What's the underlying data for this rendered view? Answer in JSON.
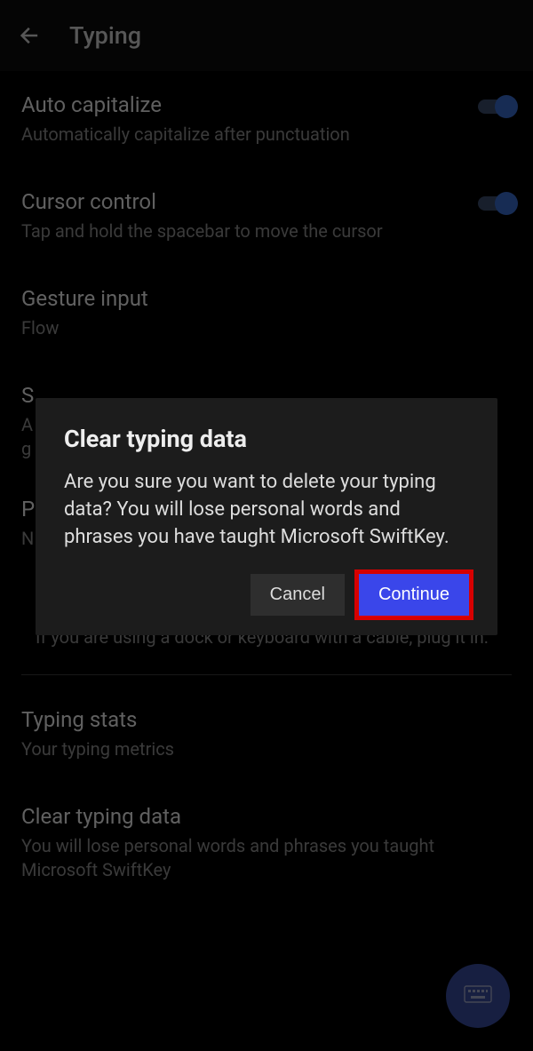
{
  "header": {
    "title": "Typing"
  },
  "settings": {
    "auto_capitalize": {
      "title": "Auto capitalize",
      "subtitle": "Automatically capitalize after punctuation"
    },
    "cursor_control": {
      "title": "Cursor control",
      "subtitle": "Tap and hold the spacebar to move the cursor"
    },
    "gesture_input": {
      "title": "Gesture input",
      "subtitle": "Flow"
    },
    "partial_top": {
      "title": "S",
      "subtitle_a": "A",
      "subtitle_b": "g"
    },
    "partial_mid": {
      "line1": "P",
      "line2": "N"
    },
    "dock_hint": "If you are using a dock or keyboard with a cable, plug it in.",
    "typing_stats": {
      "title": "Typing stats",
      "subtitle": "Your typing metrics"
    },
    "clear_typing_data": {
      "title": "Clear typing data",
      "subtitle": "You will lose personal words and phrases you taught Microsoft SwiftKey"
    }
  },
  "dialog": {
    "title": "Clear typing data",
    "body": "Are you sure you want to delete your typing data? You will lose personal words and phrases you have taught Microsoft SwiftKey.",
    "cancel": "Cancel",
    "continue": "Continue"
  }
}
